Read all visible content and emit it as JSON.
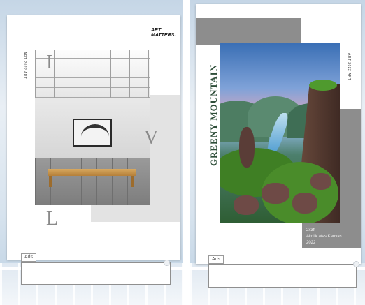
{
  "left_poster": {
    "brand_logo": [
      "ART",
      "MATTERS."
    ],
    "side_caption": "ART 2022 ART",
    "letters": {
      "top": "I",
      "middle": "V",
      "bottom": "L"
    }
  },
  "right_poster": {
    "title": "GREENY MOUNTAIN",
    "side_caption": "ART 2022 ART",
    "caption_lines": [
      "2x3ft",
      "Akrilik atas  Kanvas",
      "2022"
    ]
  },
  "ads": {
    "label": "Ads"
  },
  "colors": {
    "gray_block": "#8d8d8d",
    "title_green": "#2f4f3a"
  },
  "icons": [
    "ad-close-handle-icon"
  ]
}
